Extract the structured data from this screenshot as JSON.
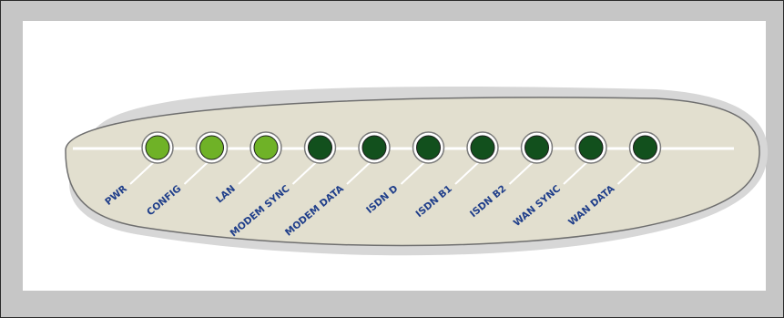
{
  "panel": {
    "leds": [
      {
        "label": "PWR",
        "state": "on"
      },
      {
        "label": "CONFIG",
        "state": "on"
      },
      {
        "label": "LAN",
        "state": "on"
      },
      {
        "label": "MODEM SYNC",
        "state": "off"
      },
      {
        "label": "MODEM DATA",
        "state": "off"
      },
      {
        "label": "ISDN D",
        "state": "off"
      },
      {
        "label": "ISDN B1",
        "state": "off"
      },
      {
        "label": "ISDN B2",
        "state": "off"
      },
      {
        "label": "WAN SYNC",
        "state": "off"
      },
      {
        "label": "WAN DATA",
        "state": "off"
      }
    ]
  },
  "colors": {
    "led_on": "#6fb227",
    "led_off": "#12501d",
    "label": "#1f3e8a",
    "panel_fill": "#e2dfcf",
    "outer_frame": "#c6c6c6"
  }
}
